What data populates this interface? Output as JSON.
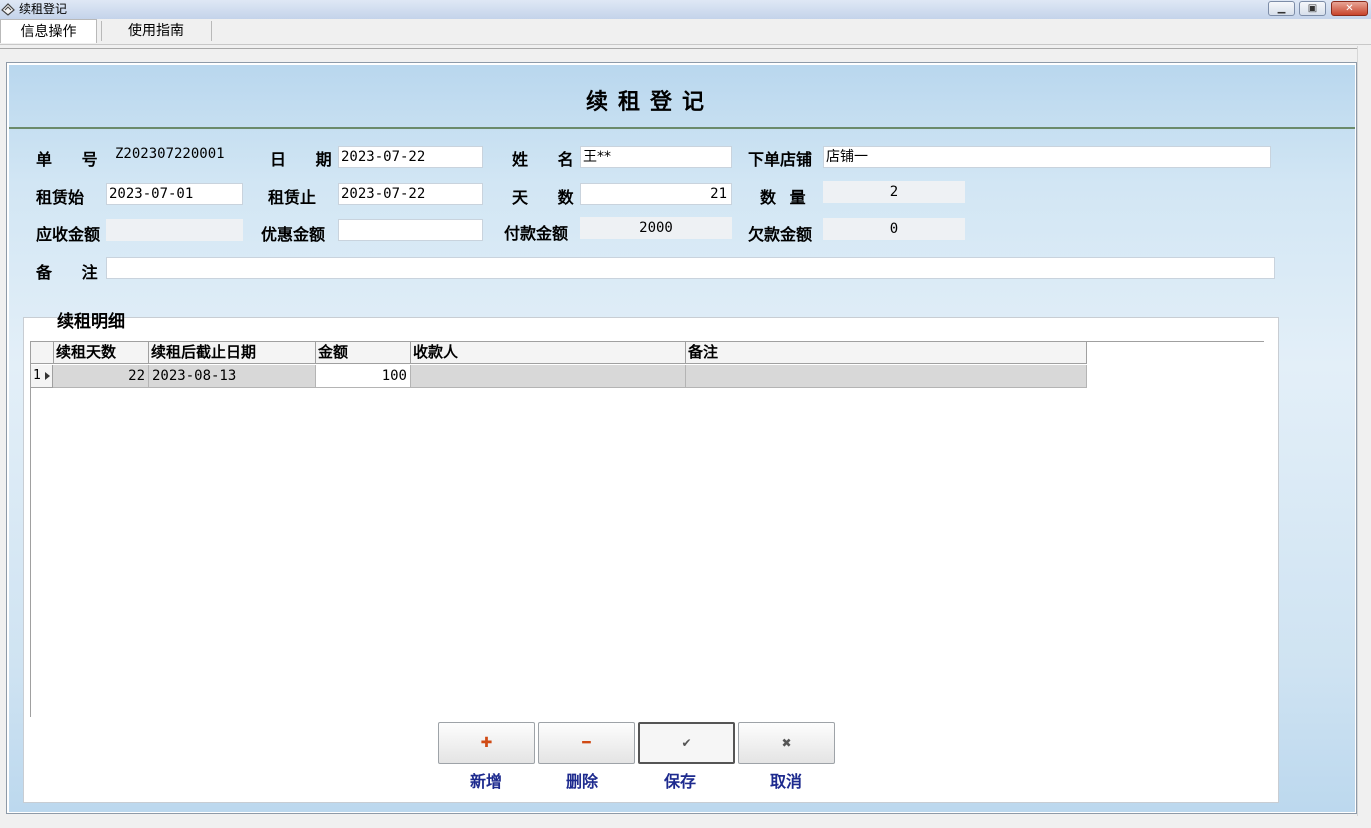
{
  "window": {
    "title": "续租登记"
  },
  "menu": {
    "items": [
      "信息操作",
      "使用指南"
    ]
  },
  "page": {
    "title": "续租登记"
  },
  "form": {
    "order_no_label": "单 号",
    "order_no": "Z202307220001",
    "date_label": "日 期",
    "date": "2023-07-22",
    "name_label": "姓 名",
    "name": "王**",
    "store_label": "下单店铺",
    "store": "店铺一",
    "rent_start_label": "租赁始",
    "rent_start": "2023-07-01",
    "rent_end_label": "租赁止",
    "rent_end": "2023-07-22",
    "days_label": "天 数",
    "days": "21",
    "qty_label": "数 量",
    "qty": "2",
    "receivable_label": "应收金额",
    "receivable": "",
    "discount_label": "优惠金额",
    "discount": "",
    "paid_label": "付款金额",
    "paid": "2000",
    "owed_label": "欠款金额",
    "owed": "0",
    "remark_label": "备 注",
    "remark": ""
  },
  "detail": {
    "title": "续租明细",
    "columns": [
      "续租天数",
      "续租后截止日期",
      "金额",
      "收款人",
      "备注"
    ],
    "rows": [
      {
        "index": "1",
        "days": "22",
        "end_date": "2023-08-13",
        "amount": "100",
        "payee": "",
        "remark": ""
      }
    ]
  },
  "buttons": {
    "add": {
      "label": "新增",
      "icon": "plus-icon"
    },
    "delete": {
      "label": "删除",
      "icon": "minus-icon"
    },
    "save": {
      "label": "保存",
      "icon": "check-icon"
    },
    "cancel": {
      "label": "取消",
      "icon": "cross-icon"
    }
  },
  "colors": {
    "panel_bg": "#c8e0f2",
    "button_label": "#1d2a8e",
    "add_icon": "#d04a14"
  }
}
